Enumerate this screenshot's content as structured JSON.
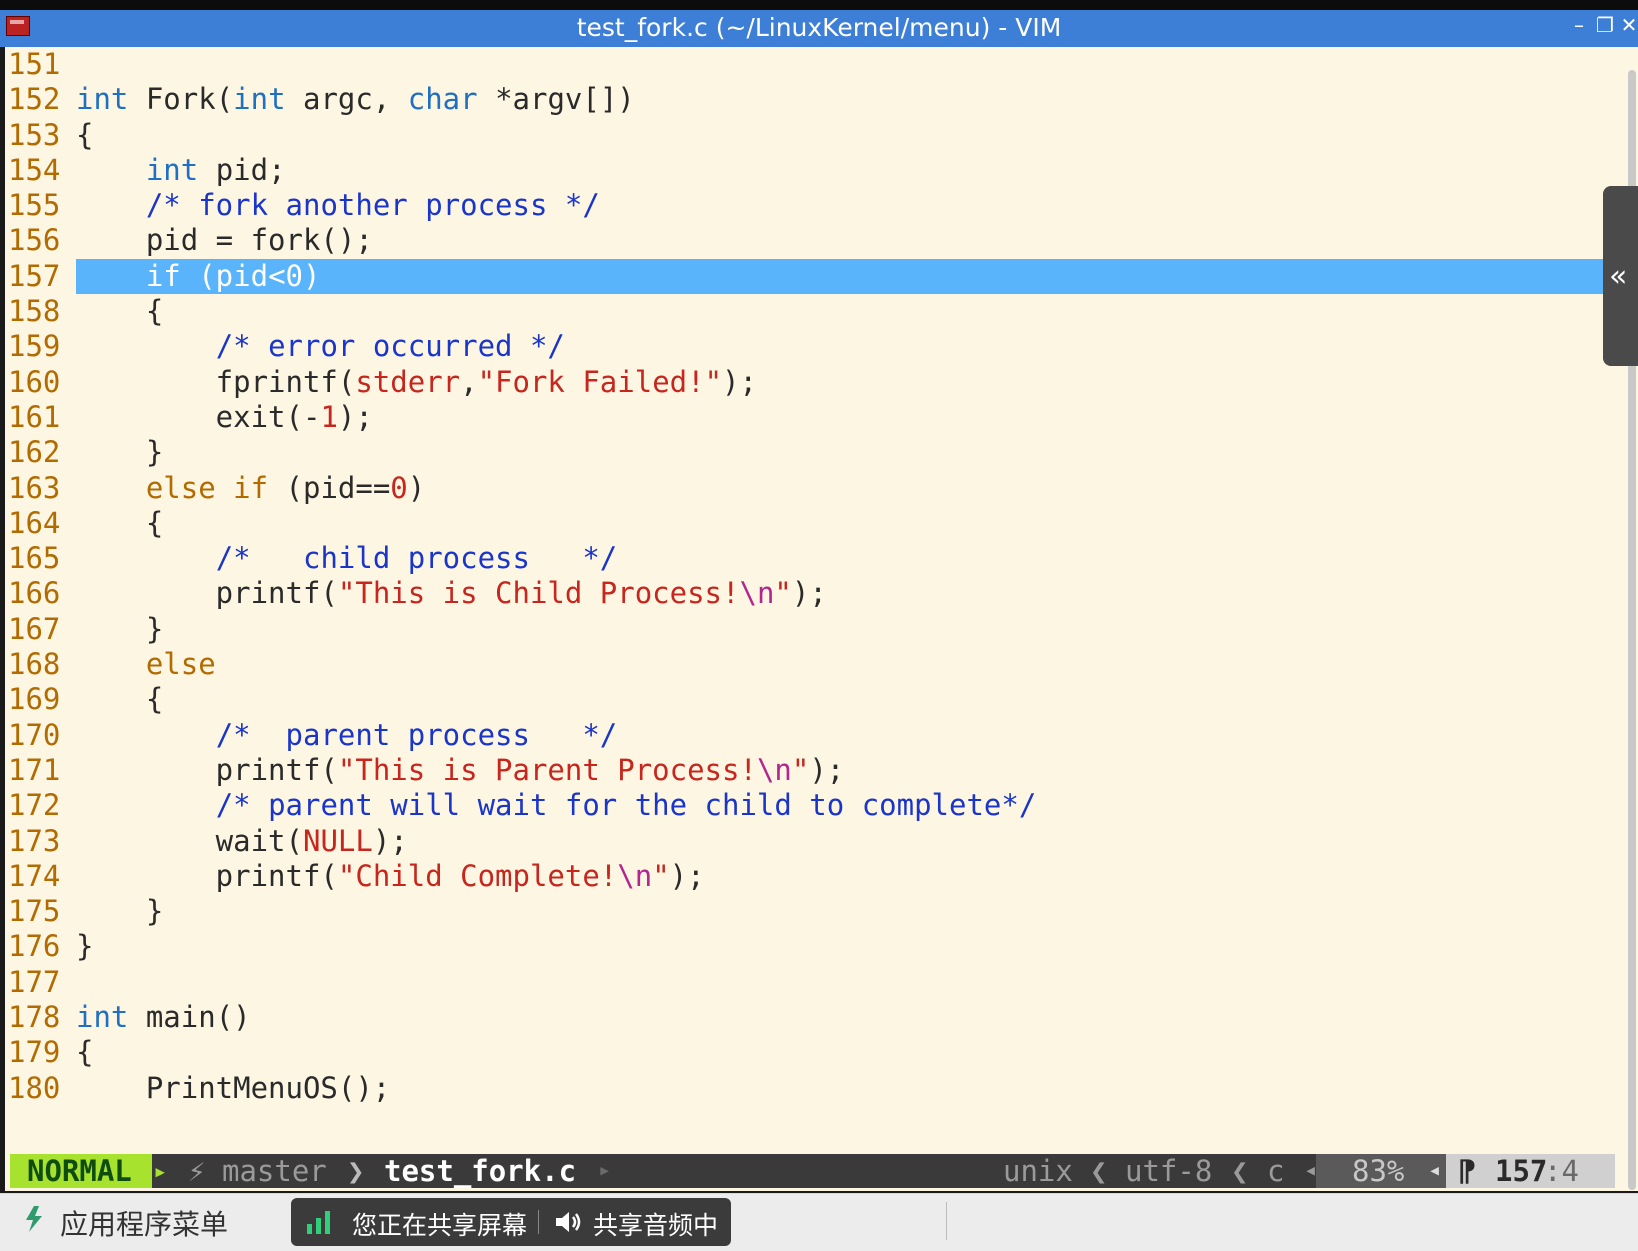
{
  "window": {
    "title": "test_fork.c (~/LinuxKernel/menu) - VIM",
    "minimize_glyph": "–",
    "restore_glyph": "❐",
    "close_glyph": "✕"
  },
  "editor": {
    "current_line_index": 6,
    "lines": [
      {
        "n": "151",
        "html": ""
      },
      {
        "n": "152",
        "html": "<span class=\"tok kw\">int</span> Fork(<span class=\"tok kw\">int</span> argc, <span class=\"tok kw\">char</span> *argv[])"
      },
      {
        "n": "153",
        "html": "{"
      },
      {
        "n": "154",
        "html": "    <span class=\"tok kw\">int</span> pid;"
      },
      {
        "n": "155",
        "html": "    <span class=\"tok cm\">/* fork another process */</span>"
      },
      {
        "n": "156",
        "html": "    pid = fork();"
      },
      {
        "n": "157",
        "html": "    <span class=\"tok kw2\">if</span> (pid&lt;<span class=\"tok num\">0</span>)"
      },
      {
        "n": "158",
        "html": "    {"
      },
      {
        "n": "159",
        "html": "        <span class=\"tok cm\">/* error occurred */</span>"
      },
      {
        "n": "160",
        "html": "        fprintf(<span class=\"tok st\">stderr</span>,<span class=\"tok st\">\"Fork Failed!\"</span>);"
      },
      {
        "n": "161",
        "html": "        exit(-<span class=\"tok num\">1</span>);"
      },
      {
        "n": "162",
        "html": "    }"
      },
      {
        "n": "163",
        "html": "    <span class=\"tok kw2\">else</span> <span class=\"tok kw2\">if</span> (pid==<span class=\"tok num\">0</span>)"
      },
      {
        "n": "164",
        "html": "    {"
      },
      {
        "n": "165",
        "html": "        <span class=\"tok cm\">/*   child process   */</span>"
      },
      {
        "n": "166",
        "html": "        printf(<span class=\"tok st\">\"This is Child Process!</span><span class=\"tok esc\">\\n</span><span class=\"tok st\">\"</span>);"
      },
      {
        "n": "167",
        "html": "    }"
      },
      {
        "n": "168",
        "html": "    <span class=\"tok kw2\">else</span>"
      },
      {
        "n": "169",
        "html": "    {"
      },
      {
        "n": "170",
        "html": "        <span class=\"tok cm\">/*  parent process   */</span>"
      },
      {
        "n": "171",
        "html": "        printf(<span class=\"tok st\">\"This is Parent Process!</span><span class=\"tok esc\">\\n</span><span class=\"tok st\">\"</span>);"
      },
      {
        "n": "172",
        "html": "        <span class=\"tok cm\">/* parent will wait for the child to complete*/</span>"
      },
      {
        "n": "173",
        "html": "        wait(<span class=\"tok st\">NULL</span>);"
      },
      {
        "n": "174",
        "html": "        printf(<span class=\"tok st\">\"Child Complete!</span><span class=\"tok esc\">\\n</span><span class=\"tok st\">\"</span>);"
      },
      {
        "n": "175",
        "html": "    }"
      },
      {
        "n": "176",
        "html": "}"
      },
      {
        "n": "177",
        "html": ""
      },
      {
        "n": "178",
        "html": "<span class=\"tok kw\">int</span> main()"
      },
      {
        "n": "179",
        "html": "{"
      },
      {
        "n": "180",
        "html": "    PrintMenuOS();"
      }
    ]
  },
  "side_panel": {
    "toggle_glyph": "«"
  },
  "statusline": {
    "mode": "NORMAL",
    "mode_arrow": "▸",
    "branch_icon": "⚡",
    "branch": "master",
    "branch_sep": "❯",
    "filename": "test_fork.c",
    "filename_arrow": "▸",
    "fileformat": "unix",
    "sep": "❮",
    "encoding": "utf-8",
    "filetype": "c",
    "left_arrow": "◂",
    "percent": "83%",
    "position_icon": "⁋",
    "line": "157",
    "col": ":4"
  },
  "taskbar": {
    "app_menu_label": "应用程序菜单",
    "sharing_label": "您正在共享屏幕",
    "audio_label": "共享音频中"
  },
  "colors": {
    "background": "#fdf6e3",
    "line_number": "#b26b00",
    "keyword_type": "#1f6fc2",
    "keyword_control": "#b26b00",
    "comment": "#1a35c9",
    "string": "#c6261e",
    "escape": "#b2268f",
    "cursorline": "#5ab4fb",
    "titlebar": "#3d7ed6",
    "mode_normal": "#a6e22e"
  }
}
